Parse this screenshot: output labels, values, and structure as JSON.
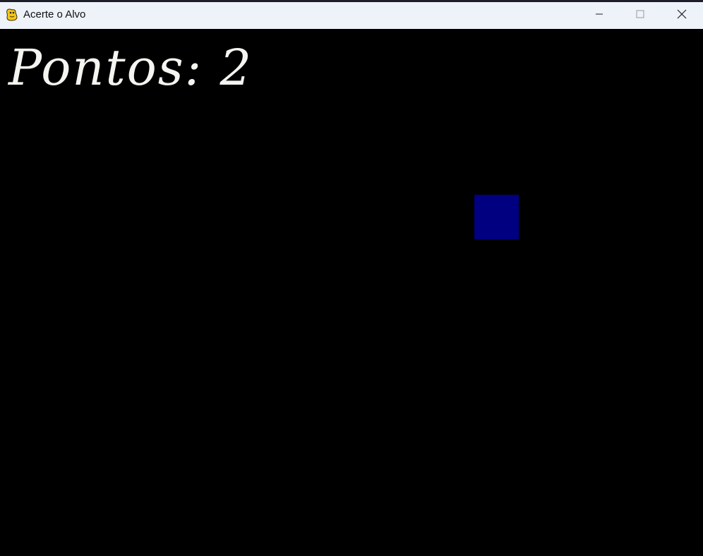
{
  "window": {
    "title": "Acerte o Alvo",
    "controls": {
      "minimize": "minimize-icon",
      "maximize": "maximize-icon",
      "close": "close-icon"
    }
  },
  "game": {
    "score_text": "Pontos: 2",
    "target_color": "#000080",
    "background_color": "#000000"
  }
}
